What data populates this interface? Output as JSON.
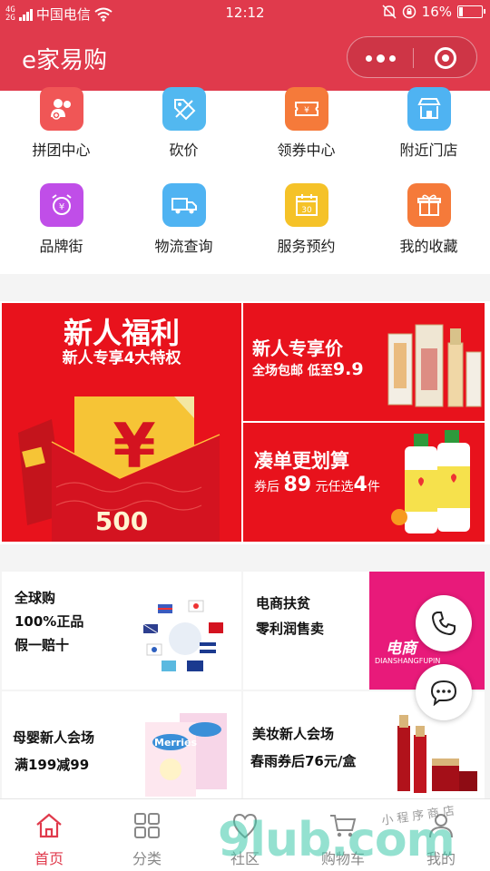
{
  "status_bar": {
    "network": "4G",
    "network2": "2G",
    "carrier": "中国电信",
    "time": "12:12",
    "battery": "16%",
    "battery_level": 0.16
  },
  "header": {
    "title": "e家易购"
  },
  "shortcuts": [
    {
      "label": "拼团中心",
      "icon": "group-buy-icon",
      "color": "#f05656"
    },
    {
      "label": "砍价",
      "icon": "price-tag-icon",
      "color": "#52b8f0"
    },
    {
      "label": "领券中心",
      "icon": "coupon-icon",
      "color": "#f57a3a"
    },
    {
      "label": "附近门店",
      "icon": "store-icon",
      "color": "#4fb3f2"
    },
    {
      "label": "品牌街",
      "icon": "brand-alarm-icon",
      "color": "#c04ee8"
    },
    {
      "label": "物流查询",
      "icon": "truck-icon",
      "color": "#4fb3f2"
    },
    {
      "label": "服务预约",
      "icon": "calendar-icon",
      "color": "#f5c228"
    },
    {
      "label": "我的收藏",
      "icon": "gift-icon",
      "color": "#f57a3a"
    }
  ],
  "promo": {
    "left": {
      "title": "新人福利",
      "subtitle": "新人专享4大特权",
      "amount": "500"
    },
    "right_top": {
      "title": "新人专享价",
      "line_prefix": "全场包邮 低至",
      "price": "9.9"
    },
    "right_bottom": {
      "title": "凑单更划算",
      "line_a": "券后",
      "num_a": "89",
      "line_b": "元任选",
      "num_b": "4",
      "line_c": "件"
    }
  },
  "cards": [
    {
      "line1": "全球购",
      "line2": "100%正品",
      "line3": "假一赔十"
    },
    {
      "line1": "电商扶贫",
      "line2": "零利润售卖",
      "image_text": "电商",
      "image_sub": "DIANSHANGFUPIN"
    },
    {
      "line1": "母婴新人会场",
      "line2": "满199减99",
      "product": "Merries"
    },
    {
      "line1": "美妆新人会场",
      "line2": "春雨券后76元/盒"
    }
  ],
  "tabs": [
    {
      "label": "首页",
      "icon": "home-icon",
      "active": true
    },
    {
      "label": "分类",
      "icon": "grid-icon",
      "active": false
    },
    {
      "label": "社区",
      "icon": "community-icon",
      "active": false
    },
    {
      "label": "购物车",
      "icon": "cart-icon",
      "active": false
    },
    {
      "label": "我的",
      "icon": "user-icon",
      "active": false
    }
  ],
  "watermark": {
    "brand": "9lub.com",
    "tagline": "小程序商店"
  },
  "colors": {
    "brand": "#e03a4c",
    "promo_red": "#e8121c",
    "active_tab": "#e03a4c"
  }
}
